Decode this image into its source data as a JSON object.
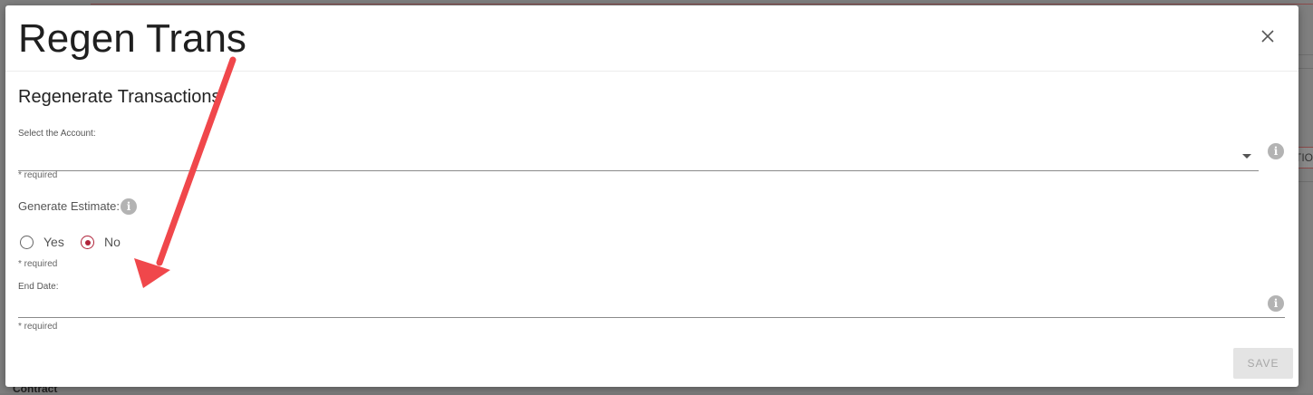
{
  "background": {
    "chip_text": "TIO",
    "contract_label": "Contract"
  },
  "modal": {
    "title": "Regen Trans",
    "close_icon": "close-icon",
    "section_title": "Regenerate Transactions",
    "account": {
      "label": "Select the Account:",
      "value": "",
      "required": "* required"
    },
    "estimate": {
      "label": "Generate Estimate:",
      "options": [
        "Yes",
        "No"
      ],
      "selected": "No",
      "required": "* required"
    },
    "end_date": {
      "label": "End Date:",
      "value": "",
      "required": "* required"
    },
    "save_label": "SAVE"
  },
  "colors": {
    "accent": "#b0233a",
    "annotation_arrow": "#f0474b"
  }
}
